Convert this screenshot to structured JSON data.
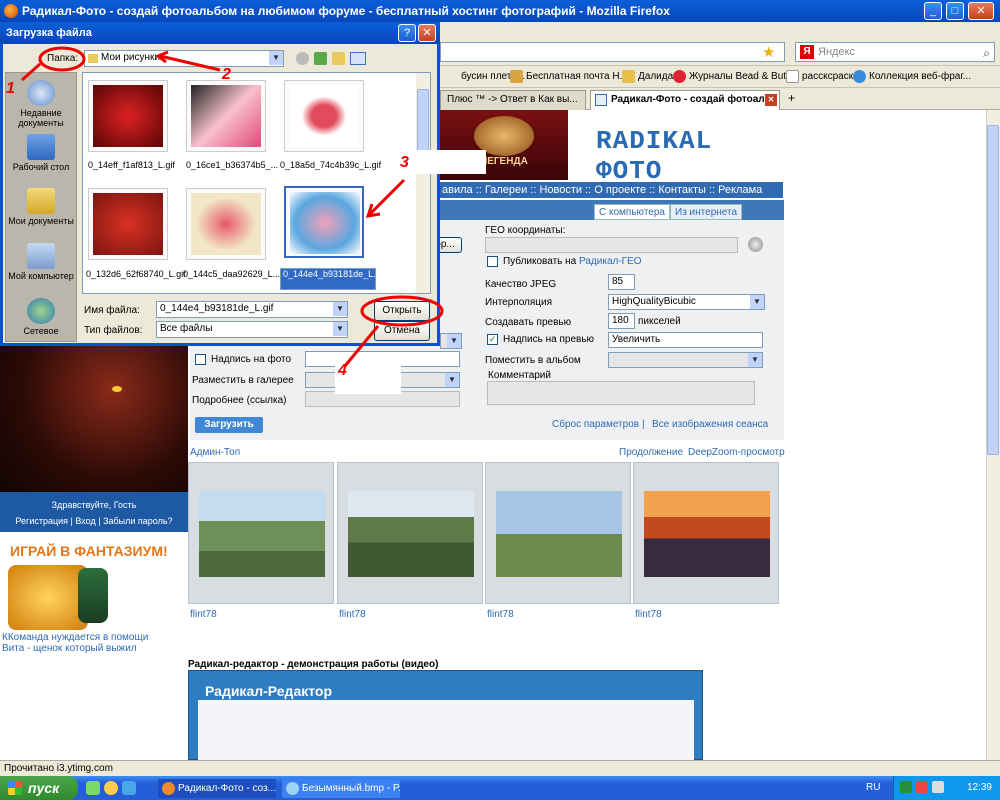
{
  "browser": {
    "title": "Радикал-Фото - создай фотоальбом на любимом форуме - бесплатный хостинг фотографий - Mozilla Firefox",
    "search_placeholder": "Яндекс",
    "bookmarks": [
      "бусин плете...",
      "Бесплатная почта Н...",
      "Далида",
      "Журналы Bead & But...",
      "рассксраски",
      "Коллекция веб-фраг..."
    ],
    "tabs": [
      "Плюс ™ -> Ответ в Как вы...",
      "Радикал-Фото - создай фотоал..."
    ],
    "status": "Прочитано i3.ytimg.com"
  },
  "dialog": {
    "title": "Загрузка файла",
    "folder_label": "Папка:",
    "folder_value": "Мои рисунки",
    "places": [
      "Недавние документы",
      "Рабочий стол",
      "Мои документы",
      "Мой компьютер",
      "Сетевое"
    ],
    "files": [
      "0_14eff_f1af813_L.gif",
      "0_16ce1_b36374b5_...",
      "0_18a5d_74c4b39c_L.gif",
      "0_132d6_62f68740_L.gif",
      "0_144c5_daa92629_L...",
      "0_144e4_b93181de_L.gif"
    ],
    "filename_label": "Имя файла:",
    "filename_value": "0_144e4_b93181de_L.gif",
    "filetype_label": "Тип файлов:",
    "filetype_value": "Все файлы",
    "open_button": "Открыть",
    "cancel_button": "Отмена",
    "help_button": "?",
    "close_button": "✕"
  },
  "annotations": [
    "1",
    "2",
    "3",
    "4"
  ],
  "site": {
    "logo_text": "ЛЕГЕНДА",
    "brand": "RADIKAL ФОТО",
    "nav": "авила :: Галереи :: Новости :: О проекте :: Контакты :: Реклама",
    "tab_computer": "С компьютера",
    "tab_internet": "Из интернета",
    "browse_button": "ор...",
    "geo_label": "ГЕО координаты:",
    "publish_geo": "Публиковать на",
    "publish_geo_link": "Радикал-ГЕО",
    "jpeg_label": "Качество JPEG",
    "jpeg_value": "85",
    "interp_label": "Интерполяция",
    "interp_value": "HighQualityBicubic",
    "preview_label": "Создавать превью",
    "preview_value": "180",
    "preview_unit": "пикселей",
    "caption_label": "Надпись на превью",
    "caption_value": "Увеличить",
    "album_label": "Поместить в альбом",
    "comment_label": "Комментарий",
    "photo_caption_label": "Надпись на фото",
    "gallery_label": "Разместить в галерее",
    "more_label": "Подробнее (ссылка)",
    "upload_button": "Загрузить",
    "reset_link": "Сброс параметров",
    "session_link": "Все изображения сеанса",
    "admin_top": "Админ-Топ",
    "continue_link": "Продолжение",
    "deepzoom_link": "DeepZoom-просмотр",
    "gallery_user": "flint78",
    "video_title": "Радикал-редактор - демонстрация работы (видео)",
    "video_label": "Радикал-Редактор"
  },
  "sidebar": {
    "greeting": "Здравствуйте, Гость",
    "links": "Регистрация | Вход | Забыли пароль?",
    "game_title": "ИГРАЙ В ФАНТАЗИУМ!",
    "news1": "ККоманда нуждается в помощи",
    "news2": "Вита - щенок который выжил"
  },
  "taskbar": {
    "start": "пуск",
    "tasks": [
      "Радикал-Фото - соз...",
      "Безымянный.bmp - P..."
    ],
    "lang": "RU",
    "clock": "12:39"
  },
  "colors": {
    "accent": "#2f6ab2",
    "annotation": "#e00000",
    "titlebar": "#0a5fd8"
  }
}
